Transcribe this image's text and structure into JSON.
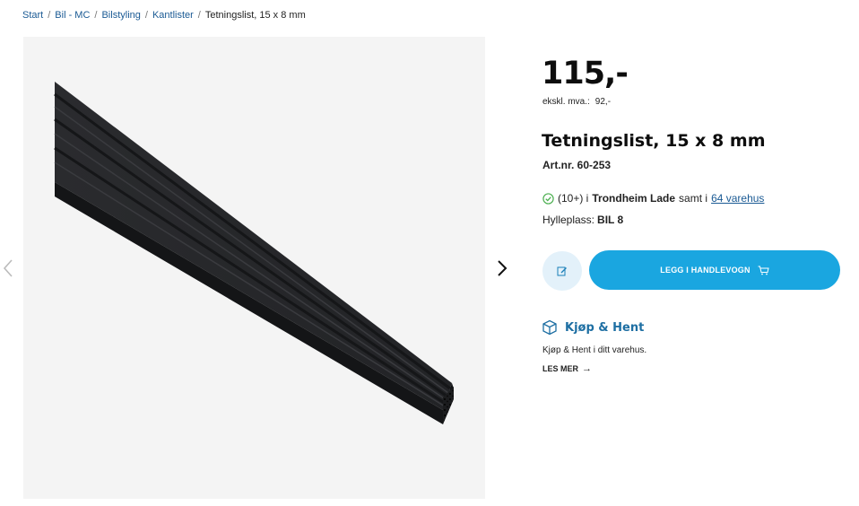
{
  "breadcrumb": {
    "items": [
      "Start",
      "Bil - MC",
      "Bilstyling",
      "Kantlister"
    ],
    "current": "Tetningslist, 15 x 8 mm",
    "separator": "/"
  },
  "product": {
    "price": "115,-",
    "ex_vat_label": "ekskl. mva.:",
    "ex_vat_value": "92,-",
    "title": "Tetningslist, 15 x 8 mm",
    "art_nr": "Art.nr. 60-253"
  },
  "stock": {
    "count": "(10+) i",
    "store": "Trondheim Lade",
    "middle": "samt i",
    "link": "64 varehus",
    "shelf_label": "Hylleplass:",
    "shelf_value": "BIL 8"
  },
  "actions": {
    "cart_label": "LEGG I HANDLEVOGN"
  },
  "click_collect": {
    "title": "Kjøp & Hent",
    "description": "Kjøp & Hent i ditt varehus.",
    "more": "LES MER",
    "more_arrow": "→"
  },
  "icons": {
    "prev": "chevron-left-icon",
    "next": "chevron-right-icon",
    "stock": "check-circle-icon",
    "note": "edit-note-icon",
    "cart": "cart-icon",
    "box": "box-icon"
  },
  "colors": {
    "accent": "#1aa6e0",
    "link": "#1a5a94",
    "heading_blue": "#1e6fa3",
    "stock_ok": "#4caf50",
    "note_bg": "#e3f1fa"
  }
}
